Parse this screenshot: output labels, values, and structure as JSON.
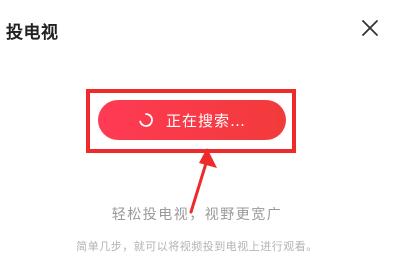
{
  "dialog": {
    "title": "投电视",
    "close_icon": "close-icon"
  },
  "search_button": {
    "label": "正在搜索…",
    "icon": "loading-spinner-icon",
    "gradient_start": "#ff3a55",
    "gradient_end": "#f23a3a"
  },
  "annotation": {
    "box_color": "#ee2a2a",
    "arrow_color": "#ee2a2a"
  },
  "tagline": "轻松投电视，视野更宽广",
  "description": "简单几步，就可以将视频投到电视上进行观看。"
}
